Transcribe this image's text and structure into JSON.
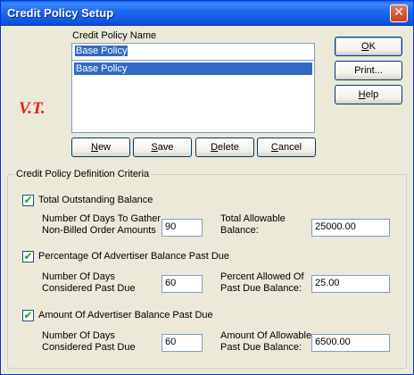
{
  "window": {
    "title": "Credit Policy Setup",
    "close_glyph": "✕"
  },
  "policy": {
    "name_label": "Credit Policy Name",
    "name_value": "Base Policy",
    "list_items": [
      "Base Policy"
    ]
  },
  "logo_text": "V.T.",
  "buttons": {
    "new": "New",
    "save": "Save",
    "delete": "Delete",
    "cancel": "Cancel",
    "ok": "OK",
    "print": "Print...",
    "help": "Help"
  },
  "criteria": {
    "group_title": "Credit Policy Definition Criteria",
    "total_outstanding": {
      "label": "Total Outstanding Balance",
      "checked": true,
      "days_label_1": "Number Of Days To Gather",
      "days_label_2": "Non-Billed Order Amounts",
      "days_value": "90",
      "amount_label_1": "Total Allowable",
      "amount_label_2": "Balance:",
      "amount_value": "25000.00"
    },
    "percentage_past_due": {
      "label": "Percentage Of Advertiser Balance Past Due",
      "checked": true,
      "days_label_1": "Number Of Days",
      "days_label_2": "Considered Past Due",
      "days_value": "60",
      "amount_label_1": "Percent Allowed Of",
      "amount_label_2": "Past Due Balance:",
      "amount_value": "25.00"
    },
    "amount_past_due": {
      "label": "Amount Of Advertiser Balance Past Due",
      "checked": true,
      "days_label_1": "Number Of Days",
      "days_label_2": "Considered Past Due",
      "days_value": "60",
      "amount_label_1": "Amount Of Allowable",
      "amount_label_2": "Past Due Balance:",
      "amount_value": "6500.00"
    },
    "check_glyph": "✔"
  }
}
